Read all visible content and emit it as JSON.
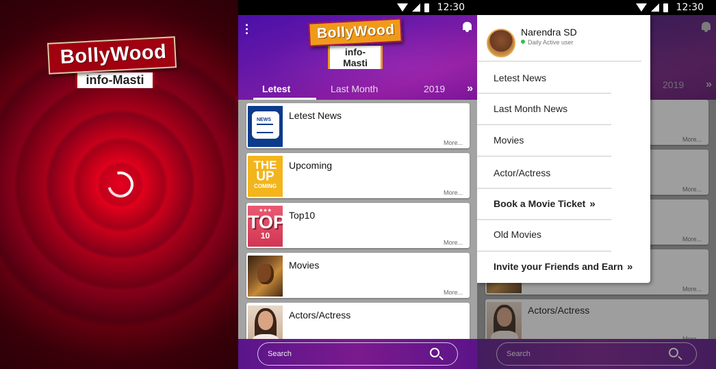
{
  "brand": {
    "name": "BollyWood",
    "tagline": "info-Masti"
  },
  "status_bar": {
    "time": "12:30"
  },
  "tabs": [
    {
      "label": "Letest"
    },
    {
      "label": "Last Month"
    },
    {
      "label": "2019"
    }
  ],
  "tab_more_glyph": "»",
  "cards": [
    {
      "title": "Letest News",
      "more": "More...",
      "thumb": "news-icon"
    },
    {
      "title": "Upcoming",
      "more": "More...",
      "thumb": "upcoming-badge",
      "thumb_lines": [
        "THE",
        "UP",
        "COMING"
      ]
    },
    {
      "title": "Top10",
      "more": "More...",
      "thumb": "top10-badge",
      "thumb_lines": [
        "★★★",
        "TOP",
        "10"
      ]
    },
    {
      "title": "Movies",
      "more": "More...",
      "thumb": "movie-poster"
    },
    {
      "title": "Actors/Actress",
      "more": "More...",
      "thumb": "actress-photo"
    }
  ],
  "search": {
    "placeholder": "Search"
  },
  "drawer": {
    "user": {
      "name": "Narendra SD",
      "status": "Daily Active user"
    },
    "items": [
      {
        "label": "Letest News"
      },
      {
        "label": "Last Month News"
      },
      {
        "label": "Movies"
      },
      {
        "label": "Actor/Actress"
      },
      {
        "label": "Book a Movie Ticket",
        "chevron": "»"
      },
      {
        "label": "Old Movies"
      },
      {
        "label": "Invite your Friends and Earn",
        "chevron": "»"
      }
    ]
  },
  "background_list": {
    "cards": [
      {
        "title": "",
        "more": "More..."
      },
      {
        "title": "",
        "more": "More..."
      },
      {
        "title": "",
        "more": "More..."
      },
      {
        "title": "",
        "more": "More..."
      },
      {
        "title": "Actors/Actress",
        "more": "More..."
      }
    ]
  },
  "colors": {
    "header_purple": "#6f1aa8",
    "splash_red": "#c2001a",
    "logo_orange": "#f09a1a",
    "online_green": "#2ec24a"
  }
}
